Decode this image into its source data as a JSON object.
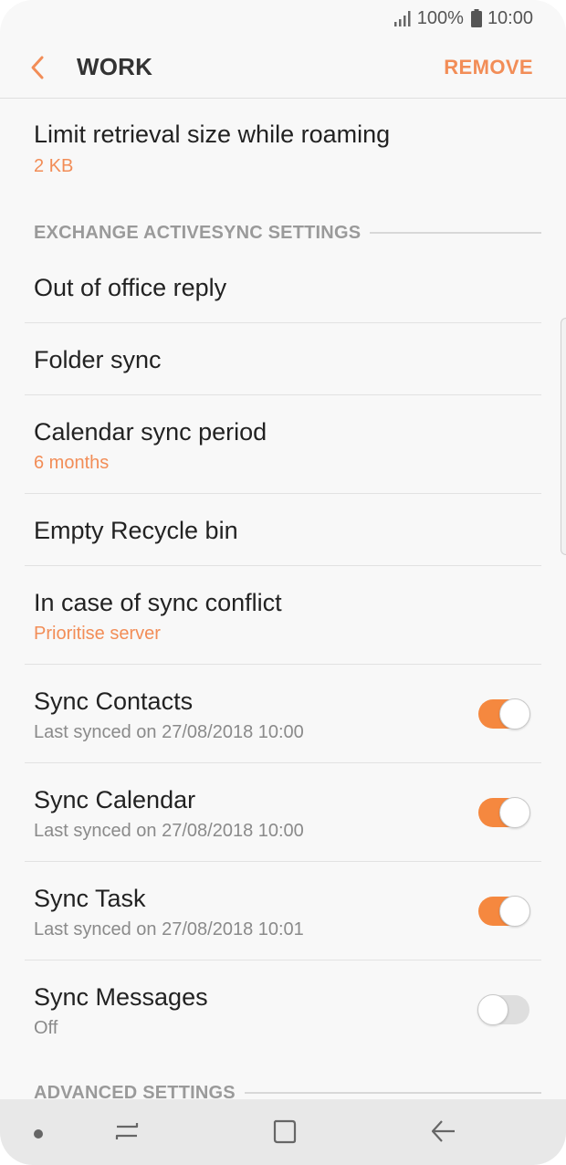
{
  "status": {
    "signal_icon": "signal-icon",
    "battery_percent": "100%",
    "battery_icon": "battery-icon",
    "time": "10:00"
  },
  "header": {
    "back_icon": "chevron-left-icon",
    "title": "WORK",
    "action": "REMOVE"
  },
  "items_top": [
    {
      "label": "Limit retrieval size while roaming",
      "value": "2 KB"
    }
  ],
  "section_exchange": "EXCHANGE ACTIVESYNC SETTINGS",
  "items": [
    {
      "label": "Out of office reply"
    },
    {
      "label": "Folder sync"
    },
    {
      "label": "Calendar sync period",
      "value": "6 months"
    },
    {
      "label": "Empty Recycle bin"
    },
    {
      "label": "In case of sync conflict",
      "value": "Prioritise server"
    },
    {
      "label": "Sync Contacts",
      "value": "Last synced on 27/08/2018  10:00",
      "toggle": "on"
    },
    {
      "label": "Sync Calendar",
      "value": "Last synced on 27/08/2018  10:00",
      "toggle": "on"
    },
    {
      "label": "Sync Task",
      "value": "Last synced on 27/08/2018  10:01",
      "toggle": "on"
    },
    {
      "label": "Sync Messages",
      "value": "Off",
      "toggle": "off"
    }
  ],
  "section_advanced": "ADVANCED SETTINGS",
  "navbar": {
    "dot_icon": "dot-icon",
    "recents_icon": "recents-icon",
    "home_icon": "home-icon",
    "back_icon": "back-arrow-icon"
  },
  "colors": {
    "accent": "#f28d57",
    "toggle_on": "#f5883f",
    "background": "#f8f8f8"
  }
}
